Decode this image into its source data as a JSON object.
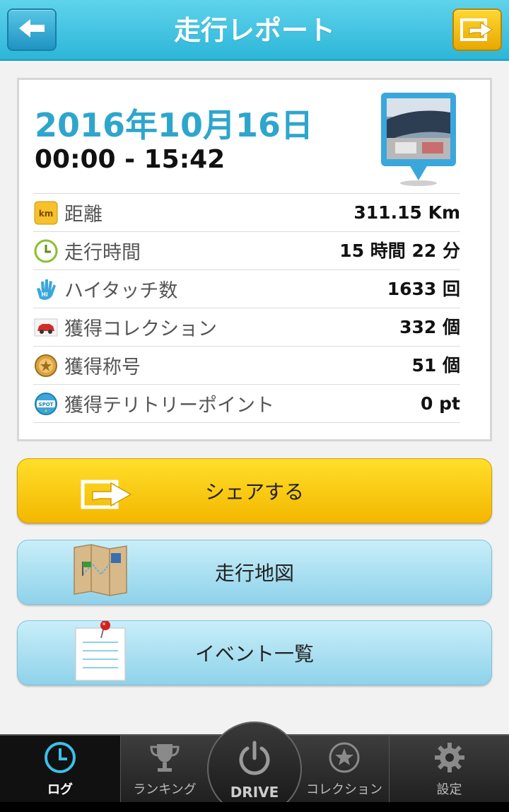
{
  "header": {
    "title": "走行レポート",
    "back_icon": "arrow-left-icon",
    "share_icon": "share-icon"
  },
  "report": {
    "date": "2016年10月16日",
    "time_range": "00:00 - 15:42",
    "stats": [
      {
        "icon": "km-icon",
        "label": "距離",
        "value": "311.15 Km"
      },
      {
        "icon": "clock-icon",
        "label": "走行時間",
        "value": "15 時間 22 分"
      },
      {
        "icon": "hand-icon",
        "label": "ハイタッチ数",
        "value": "1633 回"
      },
      {
        "icon": "car-icon",
        "label": "獲得コレクション",
        "value": "332 個"
      },
      {
        "icon": "medal-icon",
        "label": "獲得称号",
        "value": "51 個"
      },
      {
        "icon": "spot-icon",
        "label": "獲得テリトリーポイント",
        "value": "0 pt"
      }
    ]
  },
  "buttons": {
    "share": "シェアする",
    "map": "走行地図",
    "events": "イベント一覧"
  },
  "tabbar": {
    "log": "ログ",
    "ranking": "ランキング",
    "drive": "DRIVE",
    "collection": "コレクション",
    "settings": "設定"
  },
  "colors": {
    "header": "#2cb6d8",
    "date": "#2ea6cc",
    "share_button": "#f3b700",
    "blue_button": "#8ed2ea",
    "active_tab": "#3cc0e8"
  }
}
